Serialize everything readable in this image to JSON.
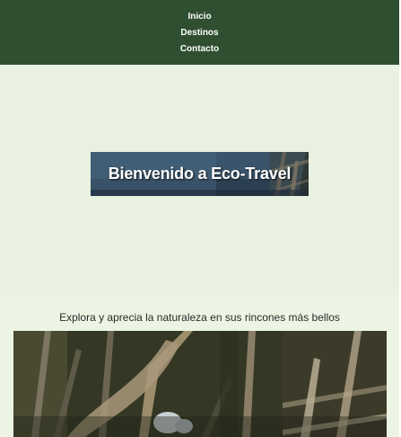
{
  "nav": {
    "items": [
      "Inicio",
      "Destinos",
      "Contacto"
    ]
  },
  "hero": {
    "banner_title": "Bienvenido a Eco-Travel"
  },
  "content": {
    "tagline": "Explora y aprecia la naturaleza en sus rincones más bellos"
  },
  "colors": {
    "nav_bg": "#2f4f30",
    "page_bg": "#ecf5e3",
    "nav_text": "#ffffff"
  }
}
